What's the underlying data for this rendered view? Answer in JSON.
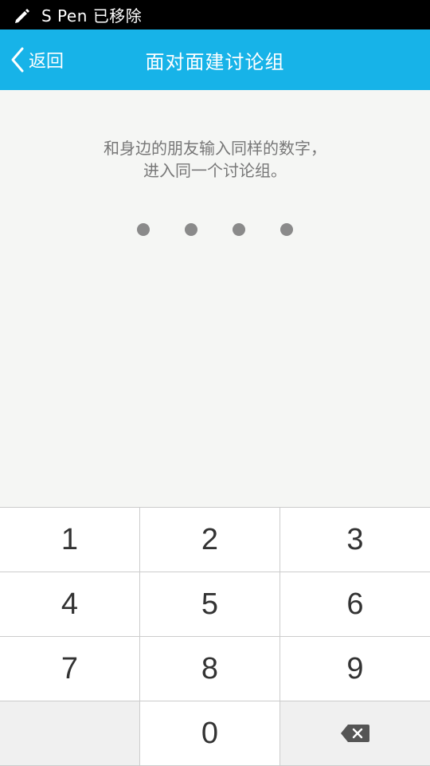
{
  "status_bar": {
    "pen_icon": "pen-icon",
    "text": "S Pen 已移除"
  },
  "header": {
    "back_label": "返回",
    "title": "面对面建讨论组",
    "accent_color": "#17b3e8"
  },
  "instructions": {
    "line1": "和身边的朋友输入同样的数字，",
    "line2": "进入同一个讨论组。"
  },
  "pin": {
    "length": 4,
    "entered": 0
  },
  "keypad": {
    "keys": [
      "1",
      "2",
      "3",
      "4",
      "5",
      "6",
      "7",
      "8",
      "9",
      "",
      "0",
      "delete"
    ],
    "delete_icon": "backspace-icon"
  }
}
